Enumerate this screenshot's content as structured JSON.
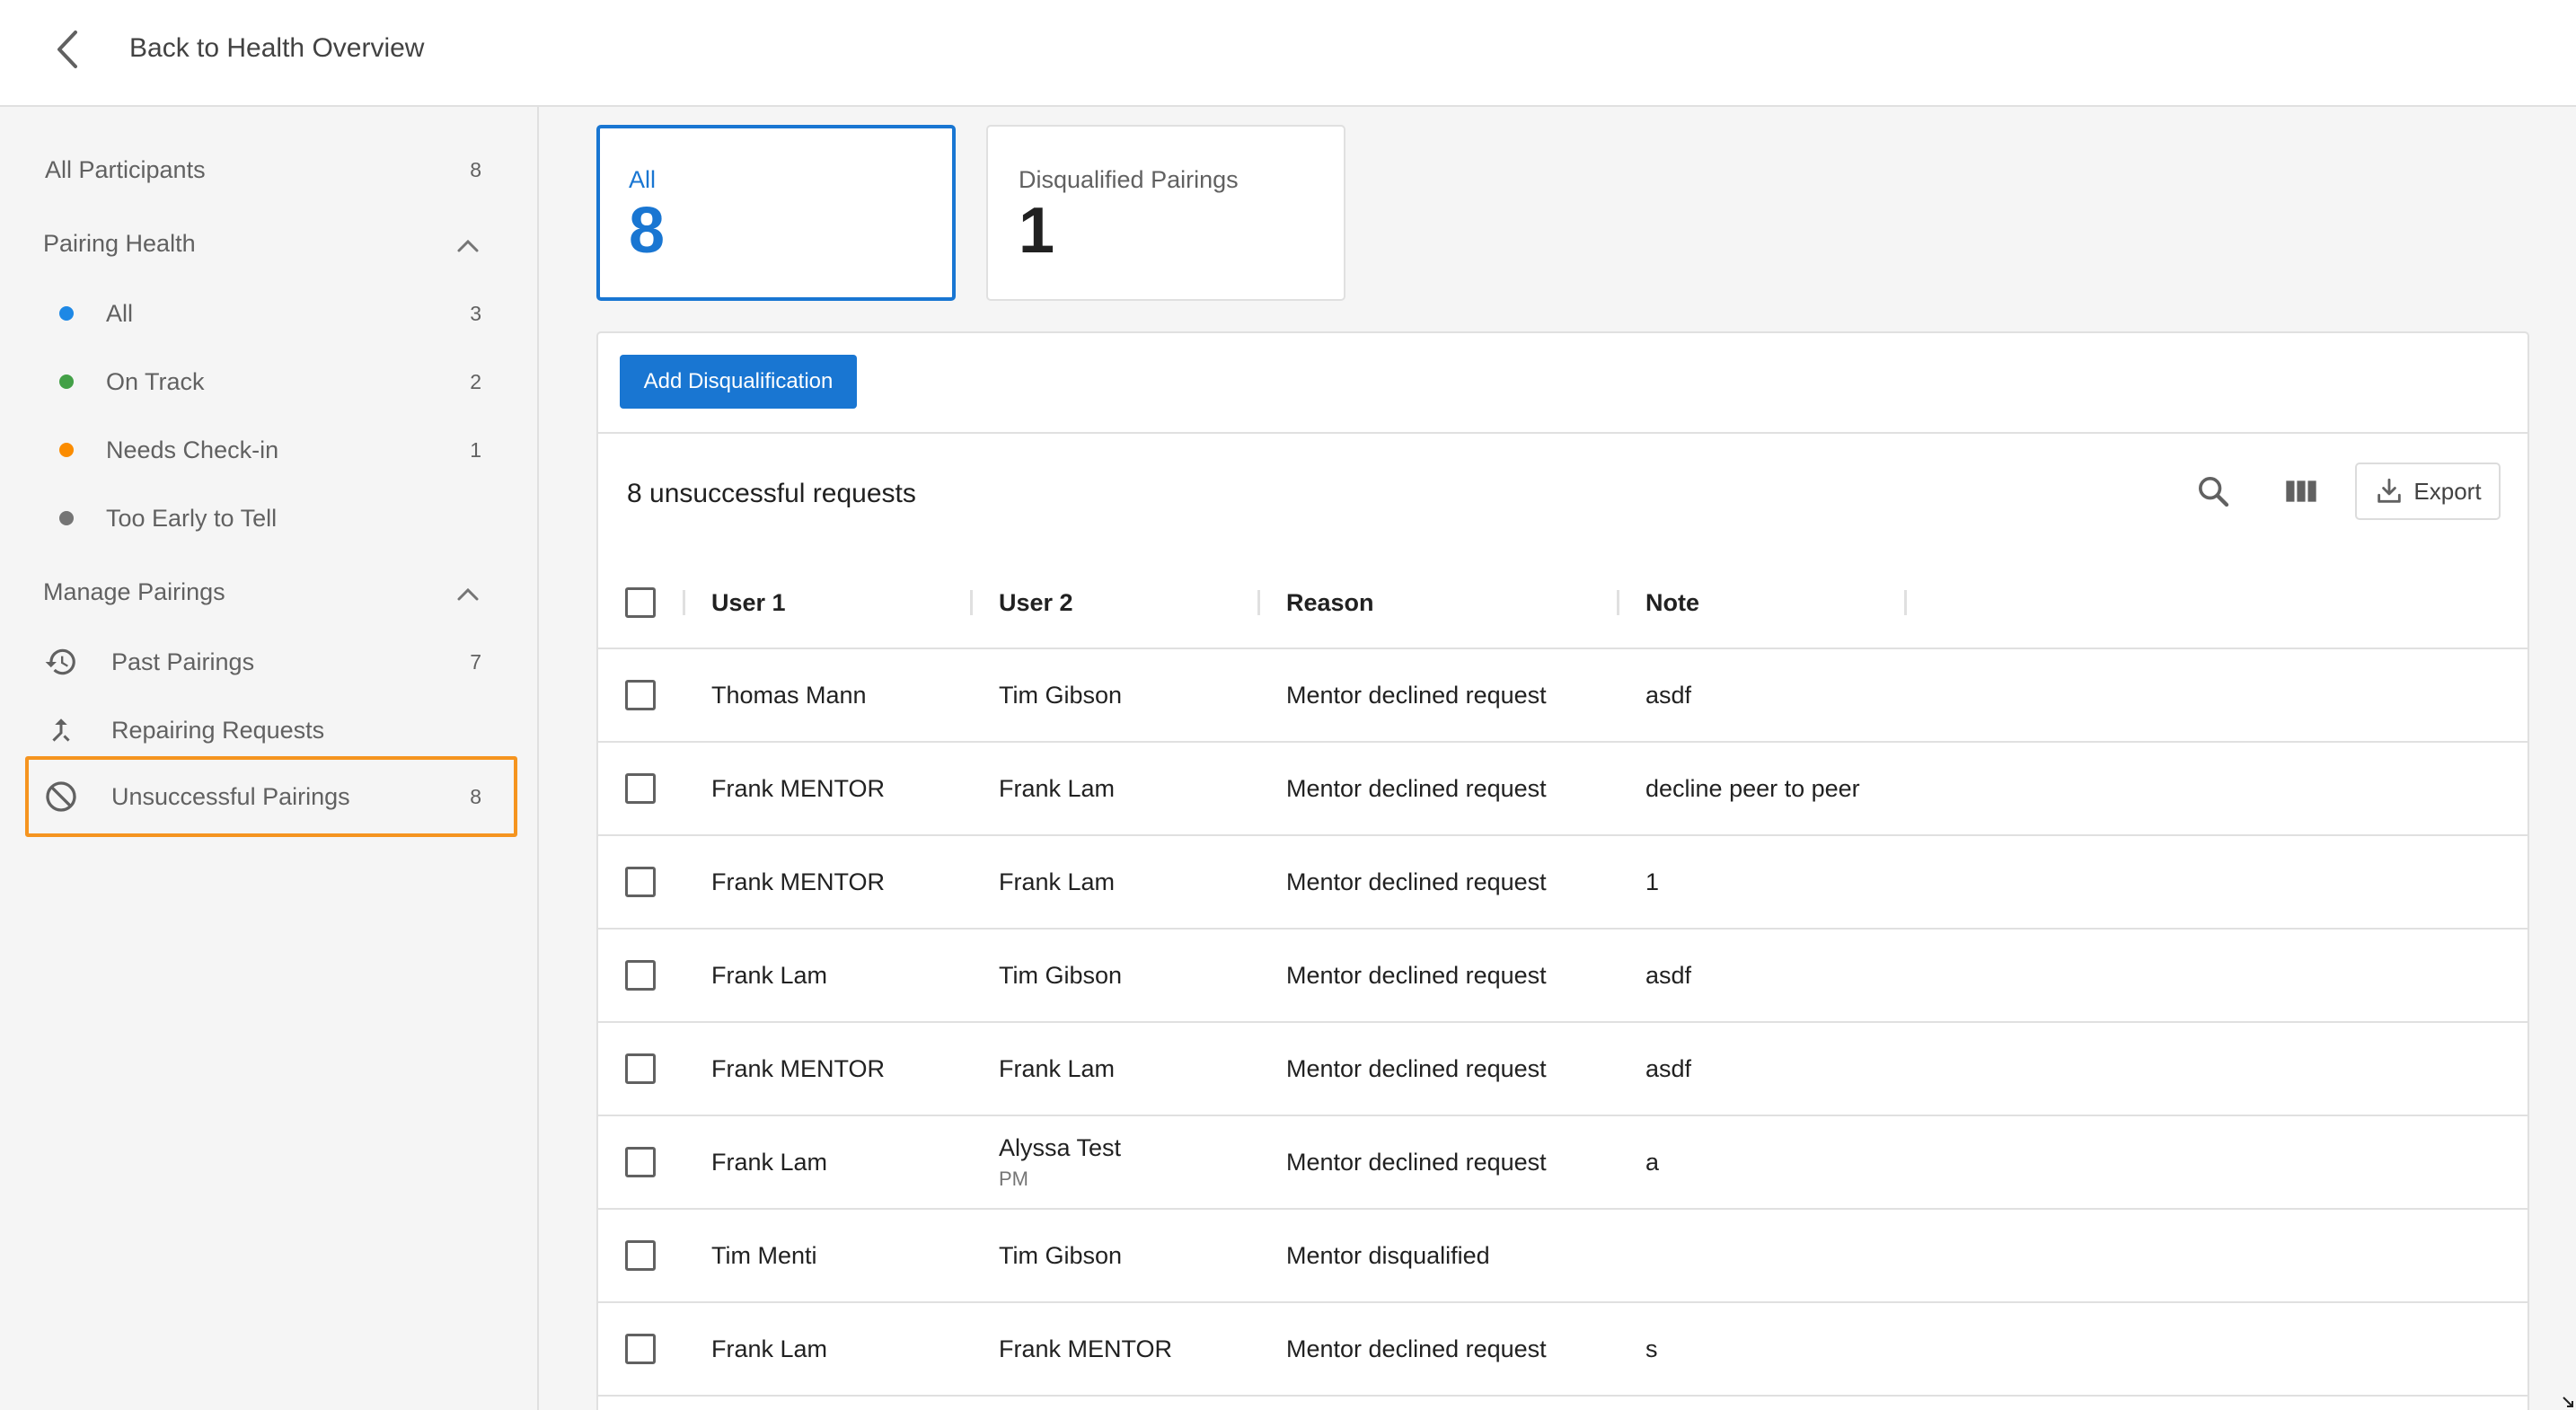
{
  "topbar": {
    "back_label": "Back to Health Overview"
  },
  "sidebar": {
    "all_participants": {
      "label": "All Participants",
      "count": "8"
    },
    "pairing_health": {
      "header": "Pairing Health",
      "items": [
        {
          "label": "All",
          "count": "3",
          "color": "#1e88e5"
        },
        {
          "label": "On Track",
          "count": "2",
          "color": "#43a047"
        },
        {
          "label": "Needs Check-in",
          "count": "1",
          "color": "#fb8c00"
        },
        {
          "label": "Too Early to Tell",
          "count": "",
          "color": "#757575"
        }
      ]
    },
    "manage_pairings": {
      "header": "Manage Pairings",
      "items": [
        {
          "label": "Past Pairings",
          "count": "7",
          "icon": "history-icon"
        },
        {
          "label": "Repairing Requests",
          "count": "",
          "icon": "merge-icon"
        },
        {
          "label": "Unsuccessful Pairings",
          "count": "8",
          "icon": "block-icon",
          "selected": true
        }
      ]
    }
  },
  "summary_cards": [
    {
      "label": "All",
      "value": "8",
      "active": true
    },
    {
      "label": "Disqualified Pairings",
      "value": "1",
      "active": false
    }
  ],
  "panel": {
    "add_button": "Add Disqualification",
    "title": "8 unsuccessful requests",
    "export_label": "Export",
    "columns": [
      "User 1",
      "User 2",
      "Reason",
      "Note"
    ],
    "rows": [
      {
        "user1": "Thomas Mann",
        "user2": "Tim Gibson",
        "user2_sub": "",
        "reason": "Mentor declined request",
        "note": "asdf"
      },
      {
        "user1": "Frank MENTOR",
        "user2": "Frank Lam",
        "user2_sub": "",
        "reason": "Mentor declined request",
        "note": "decline peer to peer"
      },
      {
        "user1": "Frank MENTOR",
        "user2": "Frank Lam",
        "user2_sub": "",
        "reason": "Mentor declined request",
        "note": "1"
      },
      {
        "user1": "Frank Lam",
        "user2": "Tim Gibson",
        "user2_sub": "",
        "reason": "Mentor declined request",
        "note": "asdf"
      },
      {
        "user1": "Frank MENTOR",
        "user2": "Frank Lam",
        "user2_sub": "",
        "reason": "Mentor declined request",
        "note": "asdf"
      },
      {
        "user1": "Frank Lam",
        "user2": "Alyssa Test",
        "user2_sub": "PM",
        "reason": "Mentor declined request",
        "note": "a"
      },
      {
        "user1": "Tim Menti",
        "user2": "Tim Gibson",
        "user2_sub": "",
        "reason": "Mentor disqualified",
        "note": ""
      },
      {
        "user1": "Frank Lam",
        "user2": "Frank MENTOR",
        "user2_sub": "",
        "reason": "Mentor declined request",
        "note": "s"
      }
    ]
  },
  "colors": {
    "accent": "#1976d2",
    "highlight": "#f5941f"
  }
}
